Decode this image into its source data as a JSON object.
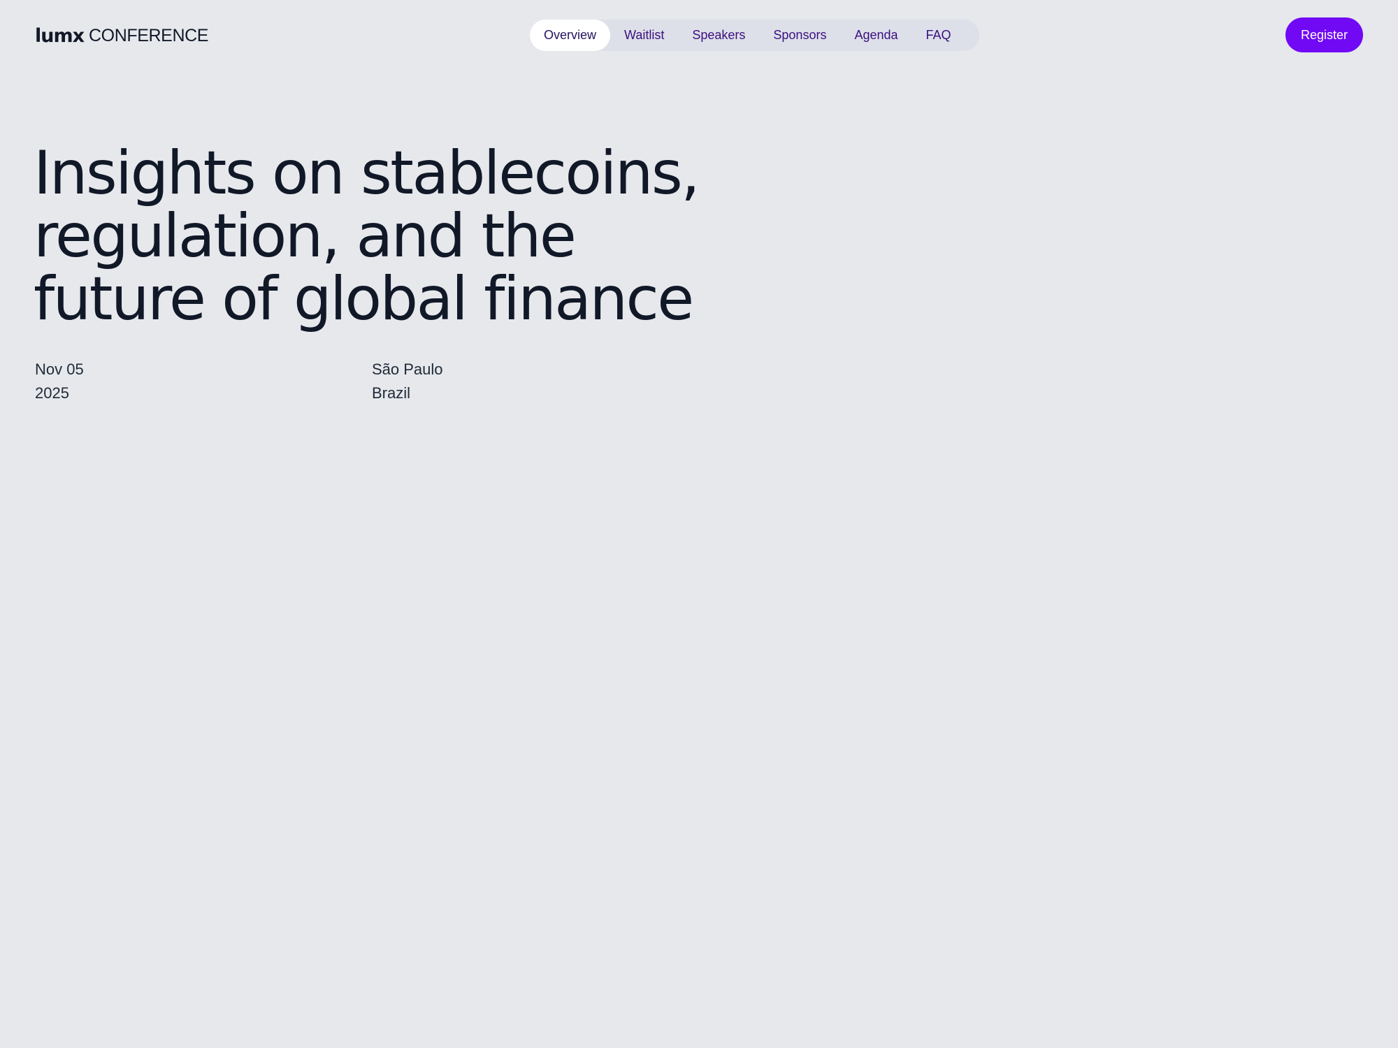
{
  "brand": {
    "mark": "lumx",
    "word": "CONFERENCE"
  },
  "nav": {
    "items": [
      {
        "label": "Overview",
        "active": true
      },
      {
        "label": "Waitlist",
        "active": false
      },
      {
        "label": "Speakers",
        "active": false
      },
      {
        "label": "Sponsors",
        "active": false
      },
      {
        "label": "Agenda",
        "active": false
      },
      {
        "label": "FAQ",
        "active": false
      }
    ]
  },
  "header": {
    "register_label": "Register"
  },
  "hero": {
    "title_lines": [
      "Insights on stablecoins,",
      "regulation, and the",
      "future of global finance"
    ],
    "date": {
      "day": "Nov 05",
      "year": "2025"
    },
    "location": {
      "city": "São Paulo",
      "country": "Brazil"
    }
  },
  "colors": {
    "background": "#e6e8ec",
    "accent": "#7109f5",
    "text": "#111827",
    "nav_text": "#3b0f80"
  }
}
